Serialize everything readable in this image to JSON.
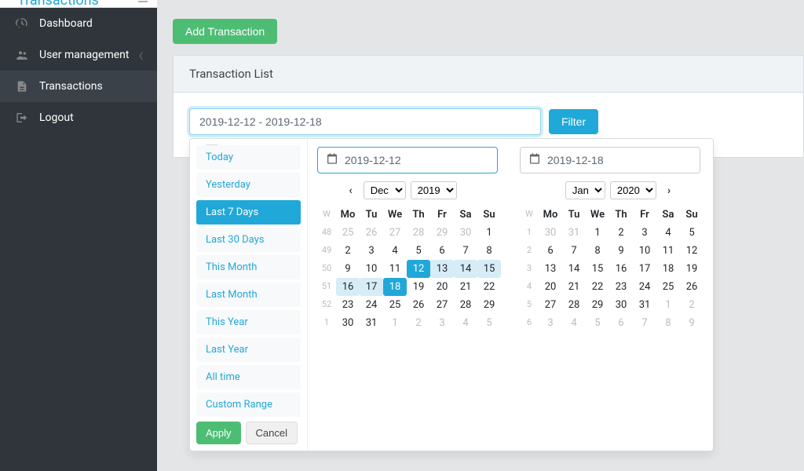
{
  "brand": "Transactions",
  "sidebar": {
    "items": [
      {
        "label": "Dashboard",
        "icon": "speedometer-icon"
      },
      {
        "label": "User management",
        "icon": "users-icon",
        "expandable": true
      },
      {
        "label": "Transactions",
        "icon": "file-icon",
        "active": true
      },
      {
        "label": "Logout",
        "icon": "logout-icon"
      }
    ]
  },
  "add_button": "Add Transaction",
  "card_title": "Transaction List",
  "filter": {
    "input_value": "2019-12-12 - 2019-12-18",
    "button": "Filter"
  },
  "drp": {
    "ranges": [
      "Today",
      "Yesterday",
      "Last 7 Days",
      "Last 30 Days",
      "This Month",
      "Last Month",
      "This Year",
      "Last Year",
      "All time",
      "Custom Range"
    ],
    "active_range_index": 2,
    "apply": "Apply",
    "cancel": "Cancel",
    "left": {
      "input": "2019-12-12",
      "month": "Dec",
      "year": "2019",
      "show_prev": true,
      "show_next": false,
      "weeks": [
        48,
        49,
        50,
        51,
        52,
        1
      ],
      "headers": [
        "W",
        "Mo",
        "Tu",
        "We",
        "Th",
        "Fr",
        "Sa",
        "Su"
      ],
      "days": [
        [
          {
            "d": 25,
            "off": true
          },
          {
            "d": 26,
            "off": true
          },
          {
            "d": 27,
            "off": true
          },
          {
            "d": 28,
            "off": true
          },
          {
            "d": 29,
            "off": true
          },
          {
            "d": 30,
            "off": true
          },
          {
            "d": 1
          }
        ],
        [
          {
            "d": 2
          },
          {
            "d": 3
          },
          {
            "d": 4
          },
          {
            "d": 5
          },
          {
            "d": 6
          },
          {
            "d": 7
          },
          {
            "d": 8
          }
        ],
        [
          {
            "d": 9
          },
          {
            "d": 10
          },
          {
            "d": 11
          },
          {
            "d": 12,
            "start": true
          },
          {
            "d": 13,
            "in": true
          },
          {
            "d": 14,
            "in": true
          },
          {
            "d": 15,
            "in": true
          }
        ],
        [
          {
            "d": 16,
            "in": true
          },
          {
            "d": 17,
            "in": true
          },
          {
            "d": 18,
            "end": true
          },
          {
            "d": 19
          },
          {
            "d": 20
          },
          {
            "d": 21
          },
          {
            "d": 22
          }
        ],
        [
          {
            "d": 23
          },
          {
            "d": 24
          },
          {
            "d": 25
          },
          {
            "d": 26
          },
          {
            "d": 27
          },
          {
            "d": 28
          },
          {
            "d": 29
          }
        ],
        [
          {
            "d": 30
          },
          {
            "d": 31
          },
          {
            "d": 1,
            "off": true
          },
          {
            "d": 2,
            "off": true
          },
          {
            "d": 3,
            "off": true
          },
          {
            "d": 4,
            "off": true
          },
          {
            "d": 5,
            "off": true
          }
        ]
      ]
    },
    "right": {
      "input": "2019-12-18",
      "month": "Jan",
      "year": "2020",
      "show_prev": false,
      "show_next": true,
      "weeks": [
        1,
        2,
        3,
        4,
        5,
        6
      ],
      "headers": [
        "W",
        "Mo",
        "Tu",
        "We",
        "Th",
        "Fr",
        "Sa",
        "Su"
      ],
      "days": [
        [
          {
            "d": 30,
            "off": true
          },
          {
            "d": 31,
            "off": true
          },
          {
            "d": 1
          },
          {
            "d": 2
          },
          {
            "d": 3
          },
          {
            "d": 4
          },
          {
            "d": 5
          }
        ],
        [
          {
            "d": 6
          },
          {
            "d": 7
          },
          {
            "d": 8
          },
          {
            "d": 9
          },
          {
            "d": 10
          },
          {
            "d": 11
          },
          {
            "d": 12
          }
        ],
        [
          {
            "d": 13
          },
          {
            "d": 14
          },
          {
            "d": 15
          },
          {
            "d": 16
          },
          {
            "d": 17
          },
          {
            "d": 18
          },
          {
            "d": 19
          }
        ],
        [
          {
            "d": 20
          },
          {
            "d": 21
          },
          {
            "d": 22
          },
          {
            "d": 23
          },
          {
            "d": 24
          },
          {
            "d": 25
          },
          {
            "d": 26
          }
        ],
        [
          {
            "d": 27
          },
          {
            "d": 28
          },
          {
            "d": 29
          },
          {
            "d": 30
          },
          {
            "d": 31
          },
          {
            "d": 1,
            "off": true
          },
          {
            "d": 2,
            "off": true
          }
        ],
        [
          {
            "d": 3,
            "off": true
          },
          {
            "d": 4,
            "off": true
          },
          {
            "d": 5,
            "off": true
          },
          {
            "d": 6,
            "off": true
          },
          {
            "d": 7,
            "off": true
          },
          {
            "d": 8,
            "off": true
          },
          {
            "d": 9,
            "off": true
          }
        ]
      ]
    }
  }
}
